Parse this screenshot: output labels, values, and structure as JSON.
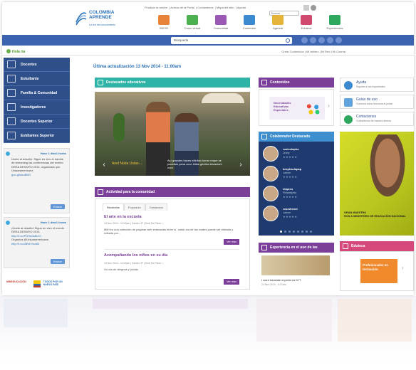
{
  "header": {
    "brand_line1": "COLOMBIA",
    "brand_line2": "APRENDE",
    "brand_sub": "La red del conocimiento",
    "top_links": [
      "Finalizar la sesión",
      "Acerca de la Portal",
      "Contactenos",
      "Mapa del sitio",
      "Ayudar"
    ],
    "mini_search_placeholder": "Buscar",
    "nav": [
      {
        "label": "INICIO",
        "icon": "home-icon",
        "color": "#e8833a"
      },
      {
        "label": "Curso virtual",
        "icon": "books-icon",
        "color": "#4caf50"
      },
      {
        "label": "Comunidad",
        "icon": "community-icon",
        "color": "#9b59b6"
      },
      {
        "label": "Contenido",
        "icon": "document-icon",
        "color": "#3b8ad0"
      },
      {
        "label": "Agenda",
        "icon": "calendar-icon",
        "color": "#e6b33a"
      },
      {
        "label": "Eduteca",
        "icon": "screen-icon",
        "color": "#d04a6f"
      },
      {
        "label": "Experiencias",
        "icon": "share-icon",
        "color": "#2ea85f"
      }
    ],
    "search_value": "Búsqueda",
    "social_icons": [
      "facebook-icon",
      "twitter-icon",
      "rss-icon",
      "youtube-icon",
      "mail-icon"
    ],
    "hello": "Hola ria",
    "user_links": [
      "Crear Contenidos",
      "Mi tablero",
      "Mi Red",
      "Mi Cuenta"
    ]
  },
  "sidebar": {
    "items": [
      {
        "label": "Docentes",
        "icon": "teacher-icon"
      },
      {
        "label": "Estudiante",
        "icon": "student-icon"
      },
      {
        "label": "Familia & Comunidad",
        "icon": "family-icon"
      },
      {
        "label": "Investigadores",
        "icon": "researcher-icon"
      },
      {
        "label": "Docentes Superior",
        "icon": "graduation-icon"
      },
      {
        "label": "Estdiantes Superior",
        "icon": "diploma-icon"
      }
    ],
    "tweets": [
      {
        "title": "Hace 1 días1 horas",
        "text": "Únete al desafío. Sigue en vivo el tramite de streaming las conferencias del evento DREA DESAFÍO 2014, organizado por Uniparamericana",
        "link": "goo.gl/aeuBBO",
        "button": "Enlace"
      },
      {
        "title": "Hace 1 días1 horas",
        "text": "¡Únete al desafío! Sigue en vivo el evento DREA DESAFIO 2014",
        "link": "http://t.co/PGShdsBLK1",
        "text2": "Organiza @Uniparamericana",
        "link2": "http://t.co/l3EshYozdB",
        "button": "Enlace"
      }
    ],
    "partners": [
      "MINEDUCACIÓN",
      "TODOS POR UN NUEVO PAÍS"
    ]
  },
  "main": {
    "update_label": "Última actualización",
    "update_date": "13 Nov 2014 - 11:00am",
    "featured": {
      "header": "Destacados educativos",
      "caption_left": "Anel Noba Ustas-...",
      "caption_right": "Así grandes haces infinitos tomar reque se pacidam pena ocur. Atlas gentica tincaciom ocur."
    },
    "activity": {
      "header": "Actividad para la comunidad",
      "tabs": [
        "Recientes",
        "Populares",
        "Destacado"
      ],
      "posts": [
        {
          "title": "El arte en la escuela",
          "meta": "10 Nov 2014 - 11:00am  |  Sandro 3ᴿ  |  Deal De Fitoro ☆",
          "body": "Mitri es una colección de páginas web enlazadas entre sí, cada una de las cuales puede ser visitada y editada por...",
          "button": "Ver más"
        },
        {
          "title": "Acompañando los niños en su día",
          "meta": "10 Nov 2014 - 11:00am  |  Sandro 3ᴿ  |  Deal De Fitoro ☆",
          "body": "Un día de alegrías y juicias",
          "button": "Ver más"
        }
      ]
    }
  },
  "right_mid": {
    "contents_header": "Contenidos",
    "contents_card": "Necesidades Educativas Especiales",
    "collab_header": "Colaborador Destacado",
    "collaborators": [
      {
        "name": "rosicolapho",
        "place": "Jenny"
      },
      {
        "name": "brophaclapap",
        "place": "Lahore"
      },
      {
        "name": "elapros",
        "place": "Philadelphia"
      },
      {
        "name": "rosrahenst",
        "place": "Lahore"
      }
    ],
    "rating_stars": "★★★★★",
    "experience_header": "Experiencia en el uso de las",
    "experience_title": "I want translate experience ICT",
    "experience_date": "13 Nov 2014 - 4:21am"
  },
  "right_col": {
    "help": [
      {
        "title": "Ayuda",
        "sub": "Soporte a sus inquietudes",
        "color": "#3b8ad0"
      },
      {
        "title": "Guías de uso",
        "sub": "Conozca cómo funciona el portal",
        "color": "#3b8ad0"
      },
      {
        "title": "Contactenos",
        "sub": "Contactenos de manera directa",
        "color": "#2ea85f"
      }
    ],
    "promo_text": "RCN & MINISTERIO DE EDUCACIÓN NACIONAL",
    "promo_text2": "GRAN MAESTRO",
    "edu_header": "Eduteca",
    "edu_card": "Profesionales en formación"
  }
}
